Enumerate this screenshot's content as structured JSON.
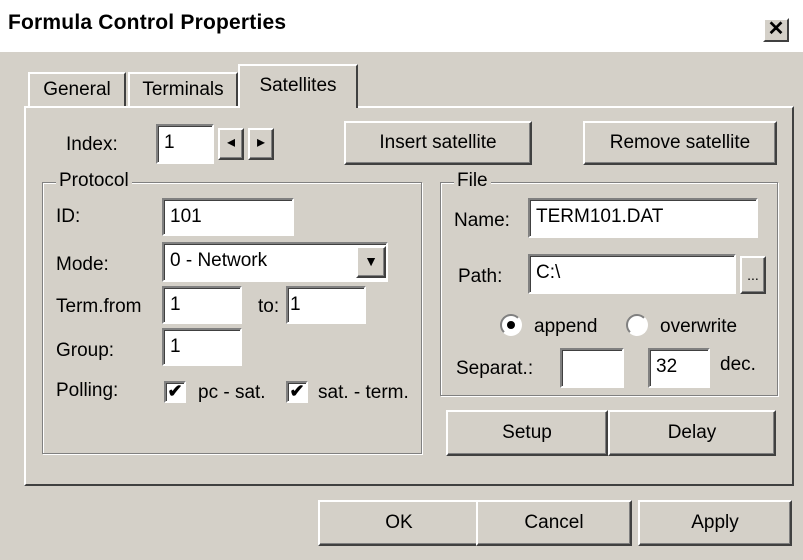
{
  "window": {
    "title": "Formula Control Properties",
    "close_glyph": "✕"
  },
  "tabs": [
    {
      "label": "General"
    },
    {
      "label": "Terminals"
    },
    {
      "label": "Satellites",
      "active": true
    }
  ],
  "satellites": {
    "index_label": "Index:",
    "index_value": "1",
    "insert_label": "Insert satellite",
    "remove_label": "Remove satellite",
    "protocol": {
      "legend": "Protocol",
      "id_label": "ID:",
      "id_value": "101",
      "mode_label": "Mode:",
      "mode_value": "0 - Network",
      "term_from_label": "Term.from",
      "term_from_value": "1",
      "to_label": "to:",
      "to_value": "1",
      "group_label": "Group:",
      "group_value": "1",
      "polling_label": "Polling:",
      "pc_sat_label": "pc - sat.",
      "pc_sat_checked": true,
      "sat_term_label": "sat. - term.",
      "sat_term_checked": true
    },
    "file": {
      "legend": "File",
      "name_label": "Name:",
      "name_value": "TERM101.DAT",
      "path_label": "Path:",
      "path_value": "C:\\",
      "browse_label": "...",
      "append_label": "append",
      "overwrite_label": "overwrite",
      "selected_mode": "append",
      "separator_label": "Separat.:",
      "separator_value": "",
      "dec_value": "32",
      "dec_label": "dec."
    },
    "setup_label": "Setup",
    "delay_label": "Delay"
  },
  "footer": {
    "ok_label": "OK",
    "cancel_label": "Cancel",
    "apply_label": "Apply"
  },
  "icons": {
    "spin_left": "◂",
    "spin_right": "▸",
    "dropdown": "▼",
    "check": "✔"
  }
}
